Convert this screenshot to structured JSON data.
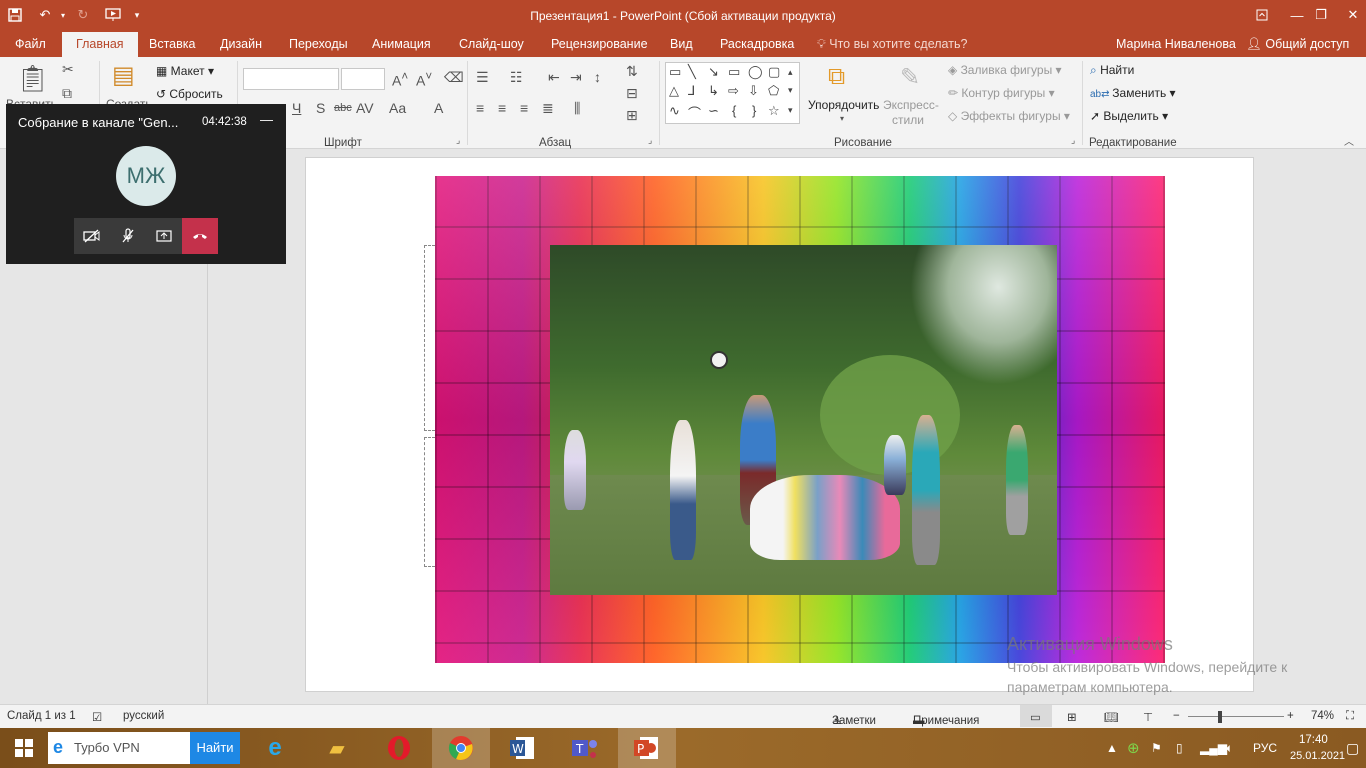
{
  "window": {
    "title": "Презентация1 - PowerPoint (Сбой активации продукта)",
    "quick_access": {
      "save_icon": "save-icon",
      "undo_icon": "undo-icon",
      "redo_icon": "redo-icon",
      "present_icon": "present-icon"
    }
  },
  "tabs": [
    {
      "label": "Файл",
      "active": false
    },
    {
      "label": "Главная",
      "active": true
    },
    {
      "label": "Вставка",
      "active": false
    },
    {
      "label": "Дизайн",
      "active": false
    },
    {
      "label": "Переходы",
      "active": false
    },
    {
      "label": "Анимация",
      "active": false
    },
    {
      "label": "Слайд-шоу",
      "active": false
    },
    {
      "label": "Рецензирование",
      "active": false
    },
    {
      "label": "Вид",
      "active": false
    },
    {
      "label": "Раскадровка",
      "active": false
    }
  ],
  "tell_me": "Что вы хотите сделать?",
  "user_name": "Марина Ниваленова",
  "share": "Общий доступ",
  "ribbon": {
    "insert_label": "Вставить",
    "create_label": "Создать",
    "layout": "Макет",
    "reset": "Сбросить",
    "groups": {
      "font": "Шрифт",
      "paragraph": "Абзац",
      "drawing": "Рисование",
      "editing": "Редактирование"
    },
    "arrange": "Упорядочить",
    "quick_styles": "Экспресс-стили",
    "quick_styles_line1": "Экспресс-",
    "quick_styles_line2": "стили",
    "shape_fill": "Заливка фигуры",
    "shape_outline": "Контур фигуры",
    "shape_effects": "Эффекты фигуры",
    "find": "Найти",
    "replace": "Заменить",
    "select": "Выделить"
  },
  "meeting": {
    "title": "Собрание в канале \"Gen...",
    "time": "04:42:38",
    "initials": "МЖ"
  },
  "watermark": {
    "line1": "Активация Windows",
    "line2": "Чтобы активировать Windows, перейдите к",
    "line3": "параметрам компьютера."
  },
  "status": {
    "slide": "Слайд 1 из 1",
    "language": "русский",
    "notes": "Заметки",
    "comments": "Примечания",
    "zoom": "74%"
  },
  "taskbar": {
    "search_placeholder": "Турбо VPN",
    "find_button": "Найти",
    "lang": "РУС",
    "time": "17:40",
    "date": "25.01.2021"
  }
}
